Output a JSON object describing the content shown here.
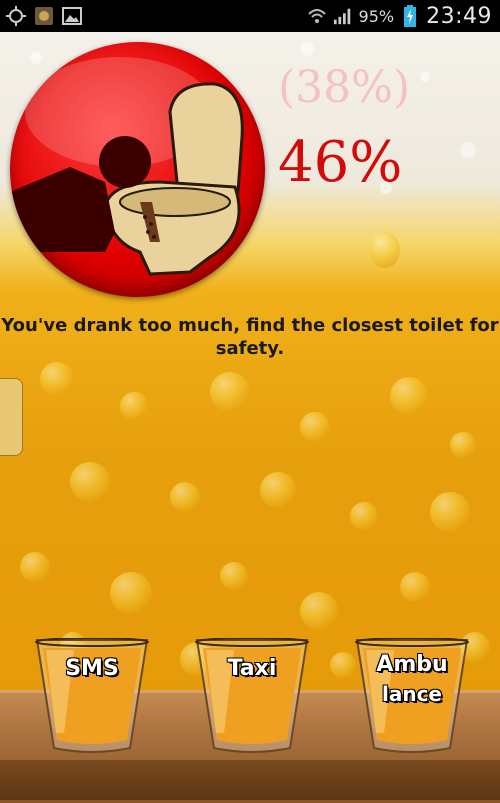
{
  "status_bar": {
    "battery": "95%",
    "time": "23:49",
    "icons": [
      "gps-icon",
      "app-notification-icon",
      "gallery-icon",
      "wifi-icon",
      "signal-icon",
      "battery-charging-icon"
    ]
  },
  "level": {
    "previous_percent": "(38%)",
    "current_percent": "46%"
  },
  "message": "You've drank too much, find the closest toilet for safety.",
  "buttons": {
    "sms": "SMS",
    "taxi": "Taxi",
    "ambulance_line1": "Ambu",
    "ambulance_line2": "lance"
  },
  "colors": {
    "accent": "#d40a0a",
    "beer": "#e9a80f",
    "circle": "#e00000"
  }
}
